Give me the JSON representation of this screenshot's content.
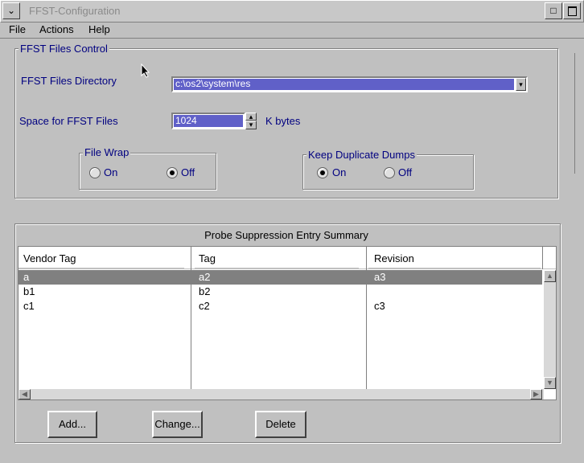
{
  "window": {
    "title": "FFST-Configuration"
  },
  "menu": {
    "file": "File",
    "actions": "Actions",
    "help": "Help"
  },
  "files_control": {
    "legend": "FFST Files Control",
    "directory_label": "FFST Files Directory",
    "directory_value": "c:\\os2\\system\\res",
    "space_label": "Space for FFST Files",
    "space_value": "1024",
    "space_unit": "K bytes"
  },
  "file_wrap": {
    "legend": "File Wrap",
    "on": "On",
    "off": "Off",
    "selected": "Off"
  },
  "keep_dumps": {
    "legend": "Keep Duplicate Dumps",
    "on": "On",
    "off": "Off",
    "selected": "On"
  },
  "summary": {
    "title": "Probe Suppression Entry Summary",
    "columns": [
      "Vendor Tag",
      "Tag",
      "Revision"
    ],
    "rows": [
      [
        "a",
        "a2",
        "a3"
      ],
      [
        "b1",
        "b2",
        ""
      ],
      [
        "c1",
        "c2",
        "c3"
      ]
    ]
  },
  "buttons": {
    "add": "Add...",
    "change": "Change...",
    "delete": "Delete"
  }
}
